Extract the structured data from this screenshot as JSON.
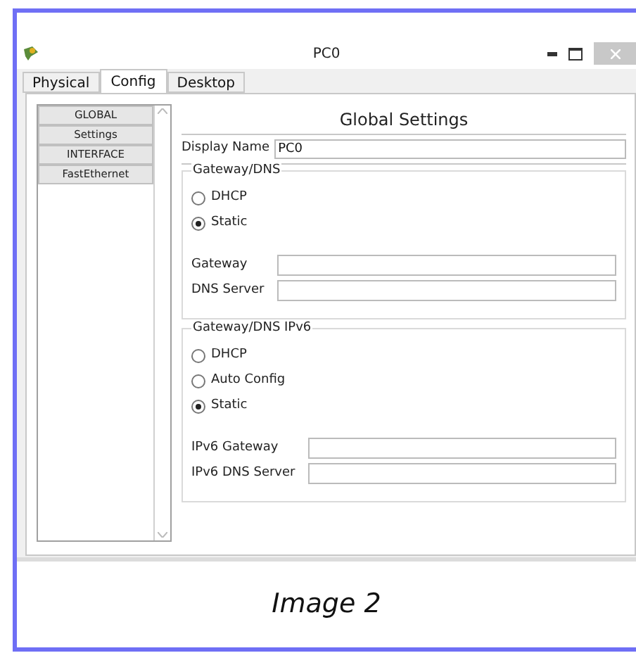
{
  "window": {
    "title": "PC0"
  },
  "tabs": [
    {
      "label": "Physical",
      "selected": false
    },
    {
      "label": "Config",
      "selected": true
    },
    {
      "label": "Desktop",
      "selected": false
    }
  ],
  "sidebar": {
    "items": [
      {
        "label": "GLOBAL"
      },
      {
        "label": "Settings"
      },
      {
        "label": "INTERFACE"
      },
      {
        "label": "FastEthernet"
      }
    ]
  },
  "heading": "Global Settings",
  "display_name": {
    "label": "Display Name",
    "value": "PC0"
  },
  "groups": [
    {
      "title": "Gateway/DNS",
      "options": [
        {
          "label": "DHCP",
          "selected": false
        },
        {
          "label": "Static",
          "selected": true
        }
      ],
      "fields": [
        {
          "label": "Gateway"
        },
        {
          "label": "DNS Server"
        }
      ]
    },
    {
      "title": "Gateway/DNS IPv6",
      "options": [
        {
          "label": "DHCP",
          "selected": false
        },
        {
          "label": "Auto Config",
          "selected": false
        },
        {
          "label": "Static",
          "selected": true
        }
      ],
      "fields": [
        {
          "label": "IPv6 Gateway"
        },
        {
          "label": "IPv6 DNS Server"
        }
      ]
    }
  ],
  "caption": "Image 2"
}
